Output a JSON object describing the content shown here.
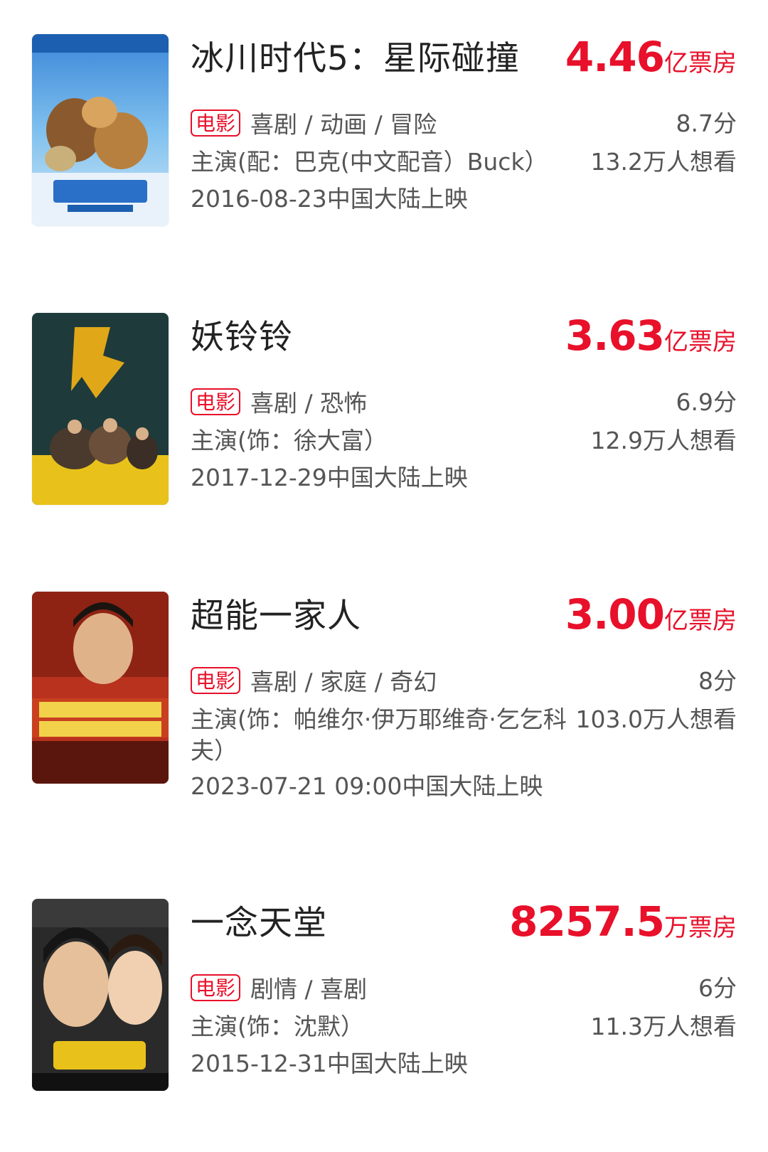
{
  "colors": {
    "accent_red": "#e8102a",
    "text_dark": "#222222",
    "text_gray": "#555555"
  },
  "movies": [
    {
      "poster_icon": "movie-poster-image",
      "title": "冰川时代5：星际碰撞",
      "box_office_num": "4.46",
      "box_office_unit": "亿票房",
      "tag": "电影",
      "genres": "喜剧 / 动画 / 冒险",
      "score": "8.7分",
      "cast": "主演(配：巴克(中文配音）Buck）",
      "want": "13.2万人想看",
      "release": "2016-08-23中国大陆上映"
    },
    {
      "poster_icon": "movie-poster-image",
      "title": "妖铃铃",
      "box_office_num": "3.63",
      "box_office_unit": "亿票房",
      "tag": "电影",
      "genres": "喜剧 / 恐怖",
      "score": "6.9分",
      "cast": "主演(饰：徐大富）",
      "want": "12.9万人想看",
      "release": "2017-12-29中国大陆上映"
    },
    {
      "poster_icon": "movie-poster-image",
      "title": "超能一家人",
      "box_office_num": "3.00",
      "box_office_unit": "亿票房",
      "tag": "电影",
      "genres": "喜剧 / 家庭 / 奇幻",
      "score": "8分",
      "cast": "主演(饰：帕维尔·伊万耶维奇·乞乞科夫）",
      "want": "103.0万人想看",
      "release": "2023-07-21 09:00中国大陆上映"
    },
    {
      "poster_icon": "movie-poster-image",
      "title": "一念天堂",
      "box_office_num": "8257.5",
      "box_office_unit": "万票房",
      "tag": "电影",
      "genres": "剧情 / 喜剧",
      "score": "6分",
      "cast": "主演(饰：沈默）",
      "want": "11.3万人想看",
      "release": "2015-12-31中国大陆上映"
    }
  ]
}
